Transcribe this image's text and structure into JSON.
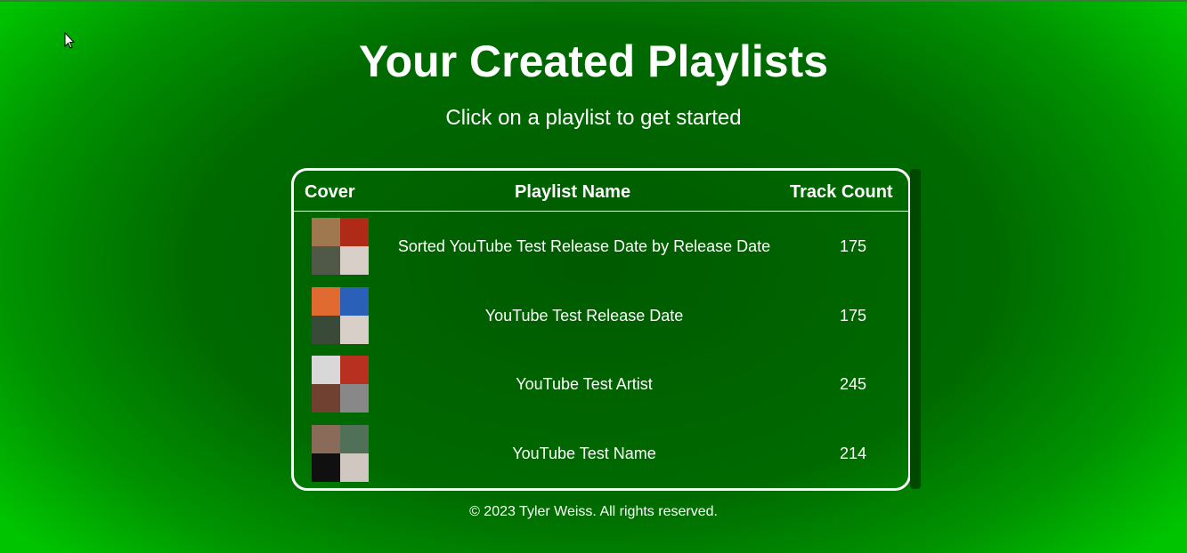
{
  "page": {
    "title": "Your Created Playlists",
    "subtitle": "Click on a playlist to get started"
  },
  "table": {
    "headers": {
      "cover": "Cover",
      "name": "Playlist Name",
      "count": "Track Count"
    },
    "rows": [
      {
        "name": "Sorted YouTube Test Release Date by Release Date",
        "count": "175",
        "cover_colors": [
          "#a07850",
          "#b02a18",
          "#505848",
          "#d8d0c8"
        ]
      },
      {
        "name": "YouTube Test Release Date",
        "count": "175",
        "cover_colors": [
          "#e06a30",
          "#2a60b8",
          "#3a4a38",
          "#d8d0c8"
        ]
      },
      {
        "name": "YouTube Test Artist",
        "count": "245",
        "cover_colors": [
          "#d8d8d8",
          "#b83020",
          "#704030",
          "#888888"
        ]
      },
      {
        "name": "YouTube Test Name",
        "count": "214",
        "cover_colors": [
          "#8a6a58",
          "#507058",
          "#101010",
          "#d0c8c0"
        ]
      }
    ]
  },
  "footer": {
    "text": "© 2023 Tyler Weiss. All rights reserved."
  },
  "colors": {
    "text": "#ffffff",
    "panel_border": "#ffffff",
    "background_center": "#005a00",
    "background_edge": "#00c400"
  }
}
